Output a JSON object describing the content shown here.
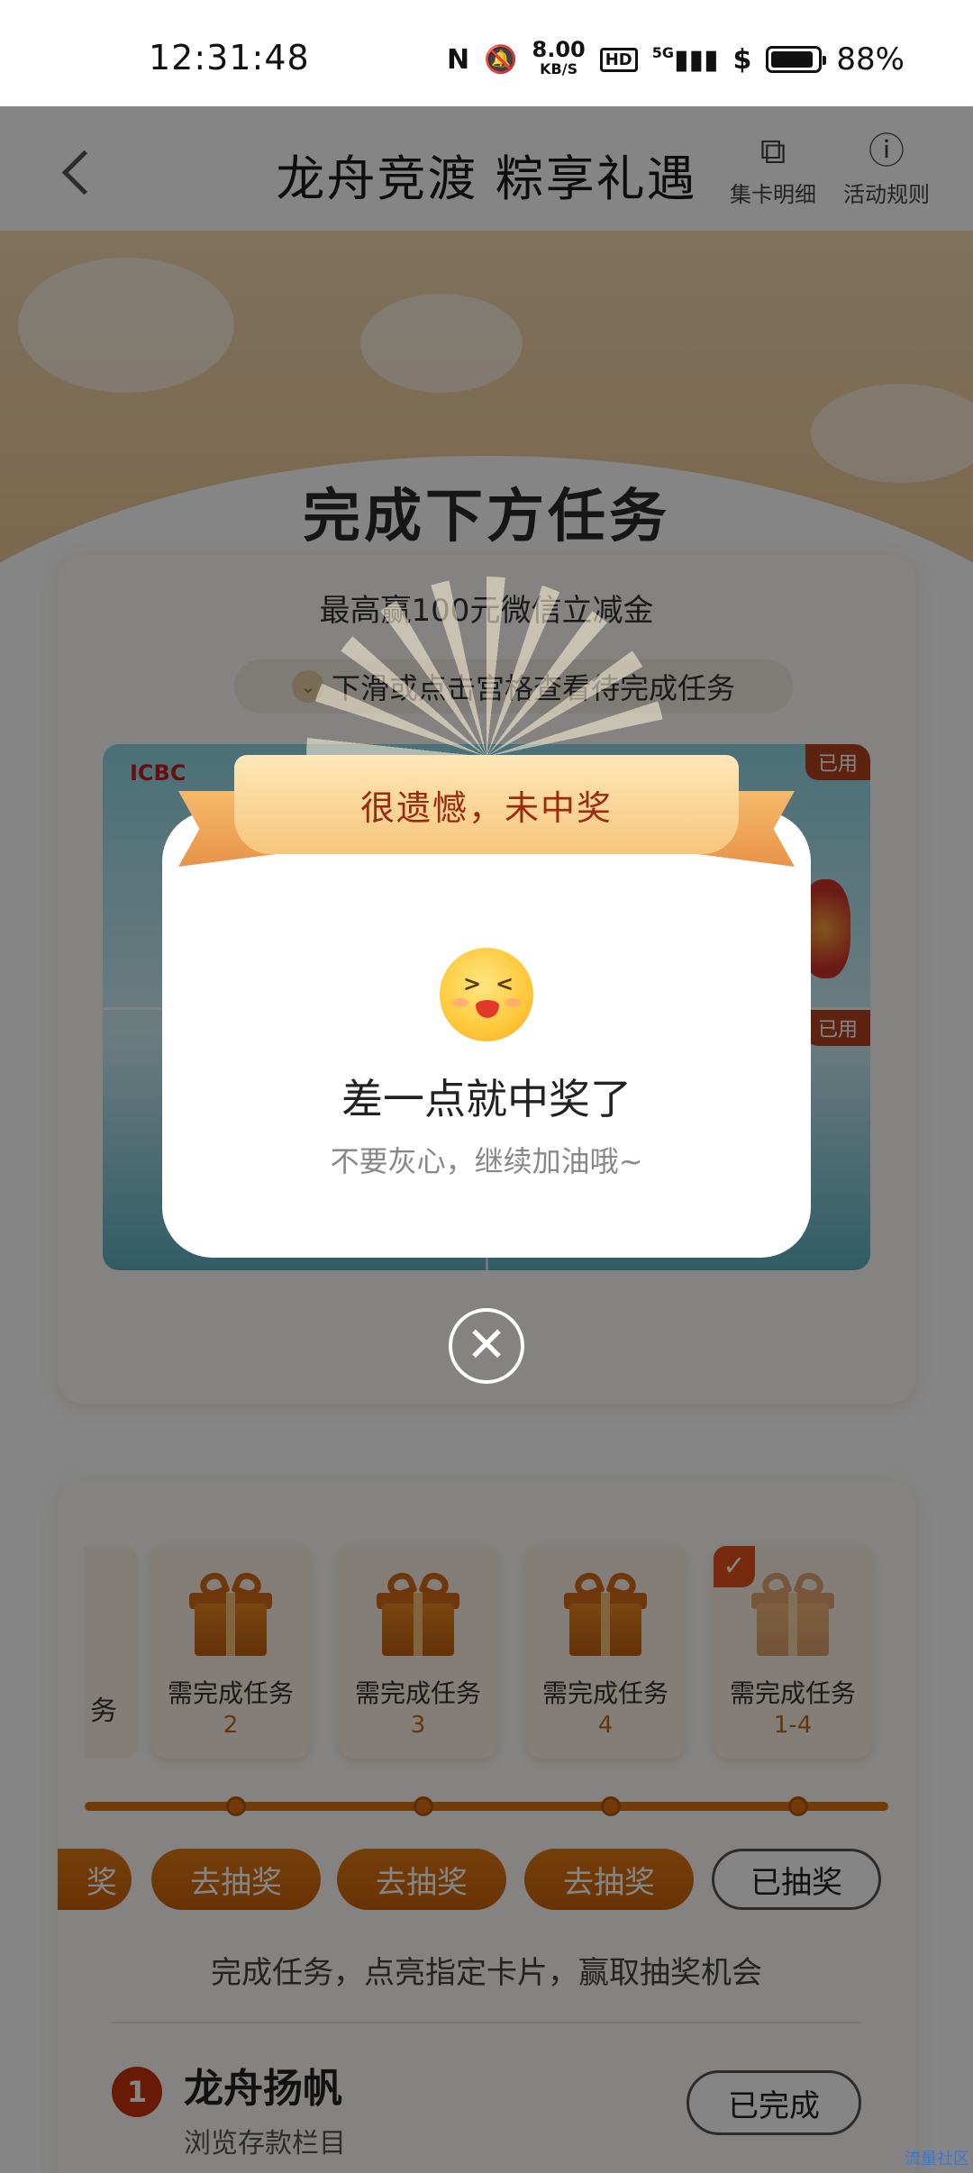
{
  "status_bar": {
    "time": "12:31:48",
    "net_speed_value": "8.00",
    "net_speed_unit": "KB/S",
    "hd": "HD",
    "signal": "5G",
    "battery": "88%"
  },
  "header": {
    "title": "龙舟竞渡 粽享礼遇",
    "card_detail": "集卡明细",
    "rules": "活动规则"
  },
  "hero": {
    "title": "完成下方任务"
  },
  "task_card": {
    "subtitle": "最高赢100元微信立减金",
    "hint": "下滑或点击宫格查看待完成任务",
    "bank": "ICBC",
    "used_tag_1": "已用",
    "used_tag_2": "已用"
  },
  "lottery": {
    "partial_label": "务",
    "prizes": [
      {
        "label": "需完成任务",
        "tasks": "2",
        "done": false
      },
      {
        "label": "需完成任务",
        "tasks": "3",
        "done": false
      },
      {
        "label": "需完成任务",
        "tasks": "4",
        "done": false
      },
      {
        "label": "需完成任务",
        "tasks": "1-4",
        "done": true
      }
    ],
    "buttons": [
      "去抽奖",
      "去抽奖",
      "去抽奖",
      "已抽奖"
    ],
    "partial_button": "奖",
    "note": "完成任务，点亮指定卡片，赢取抽奖机会",
    "tasks": [
      {
        "number": "1",
        "title": "龙舟扬帆",
        "desc": "浏览存款栏目",
        "action": "已完成"
      }
    ]
  },
  "modal": {
    "banner": "很遗憾，未中奖",
    "title": "差一点就中奖了",
    "subtitle": "不要灰心，继续加油哦~",
    "close_icon": "close-circle-icon"
  },
  "watermark": "流量社区"
}
